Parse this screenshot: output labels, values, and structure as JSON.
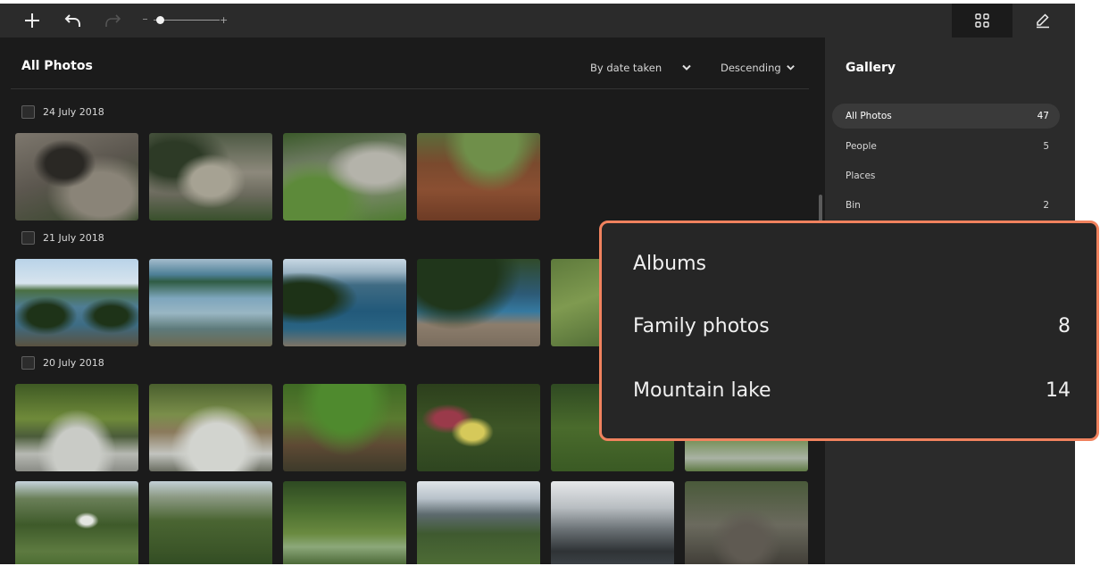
{
  "toolbar": {
    "add_icon": "plus-icon",
    "undo_icon": "undo-icon",
    "redo_icon": "redo-icon",
    "zoom_minus": "-",
    "zoom_plus": "+",
    "zoom_level": 0.1,
    "grid_icon": "grid-view-icon",
    "edit_icon": "edit-pencil-icon"
  },
  "main": {
    "title": "All Photos",
    "sort_by": "By date taken",
    "sort_order": "Descending",
    "groups": [
      {
        "date": "24 July 2018"
      },
      {
        "date": "21 July 2018"
      },
      {
        "date": "20 July 2018"
      }
    ]
  },
  "sidebar": {
    "title": "Gallery",
    "items": [
      {
        "label": "All Photos",
        "count": "47"
      },
      {
        "label": "People",
        "count": "5"
      },
      {
        "label": "Places",
        "count": ""
      },
      {
        "label": "Bin",
        "count": "2"
      }
    ]
  },
  "callout": {
    "title": "Albums",
    "albums": [
      {
        "label": "Family photos",
        "count": "8"
      },
      {
        "label": "Mountain lake",
        "count": "14"
      }
    ]
  },
  "colors": {
    "toolbar_bg": "#2b2b2b",
    "app_bg": "#1b1b1b",
    "sidebar_bg": "#2b2b2b",
    "callout_border": "#f0825e"
  }
}
